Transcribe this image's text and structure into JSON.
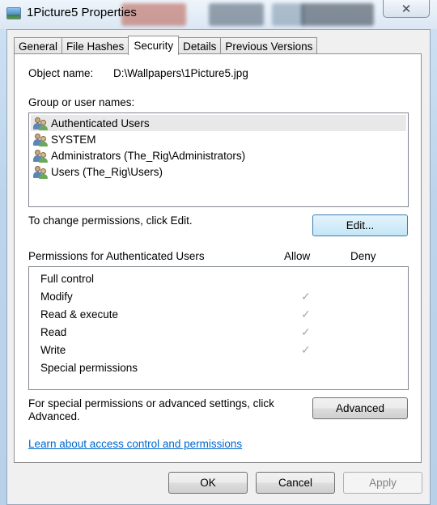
{
  "window": {
    "title": "1Picture5 Properties",
    "close_glyph": "✕"
  },
  "tabs": [
    {
      "label": "General"
    },
    {
      "label": "File Hashes"
    },
    {
      "label": "Security",
      "active": true
    },
    {
      "label": "Details"
    },
    {
      "label": "Previous Versions"
    }
  ],
  "security": {
    "object_name_label": "Object name:",
    "object_name_value": "D:\\Wallpapers\\1Picture5.jpg",
    "group_label": "Group or user names:",
    "users": [
      {
        "name": "Authenticated Users",
        "selected": true
      },
      {
        "name": "SYSTEM"
      },
      {
        "name": "Administrators (The_Rig\\Administrators)"
      },
      {
        "name": "Users (The_Rig\\Users)"
      }
    ],
    "change_text": "To change permissions, click Edit.",
    "edit_button": "Edit...",
    "permissions_label": "Permissions for Authenticated Users",
    "allow_header": "Allow",
    "deny_header": "Deny",
    "permissions": [
      {
        "name": "Full control",
        "allow": false,
        "deny": false
      },
      {
        "name": "Modify",
        "allow": true,
        "deny": false
      },
      {
        "name": "Read & execute",
        "allow": true,
        "deny": false
      },
      {
        "name": "Read",
        "allow": true,
        "deny": false
      },
      {
        "name": "Write",
        "allow": true,
        "deny": false
      },
      {
        "name": "Special permissions",
        "allow": false,
        "deny": false
      }
    ],
    "check_glyph": "✓",
    "advanced_text_line1": "For special permissions or advanced settings, click",
    "advanced_text_line2": "Advanced.",
    "advanced_button": "Advanced",
    "learn_link": "Learn about access control and permissions"
  },
  "footer": {
    "ok_button": "OK",
    "cancel_button": "Cancel",
    "apply_button": "Apply",
    "apply_disabled": true
  },
  "colors": {
    "link": "#0066cc",
    "focus_button": "#c4e5f6",
    "selection": "#e8e8e8"
  }
}
